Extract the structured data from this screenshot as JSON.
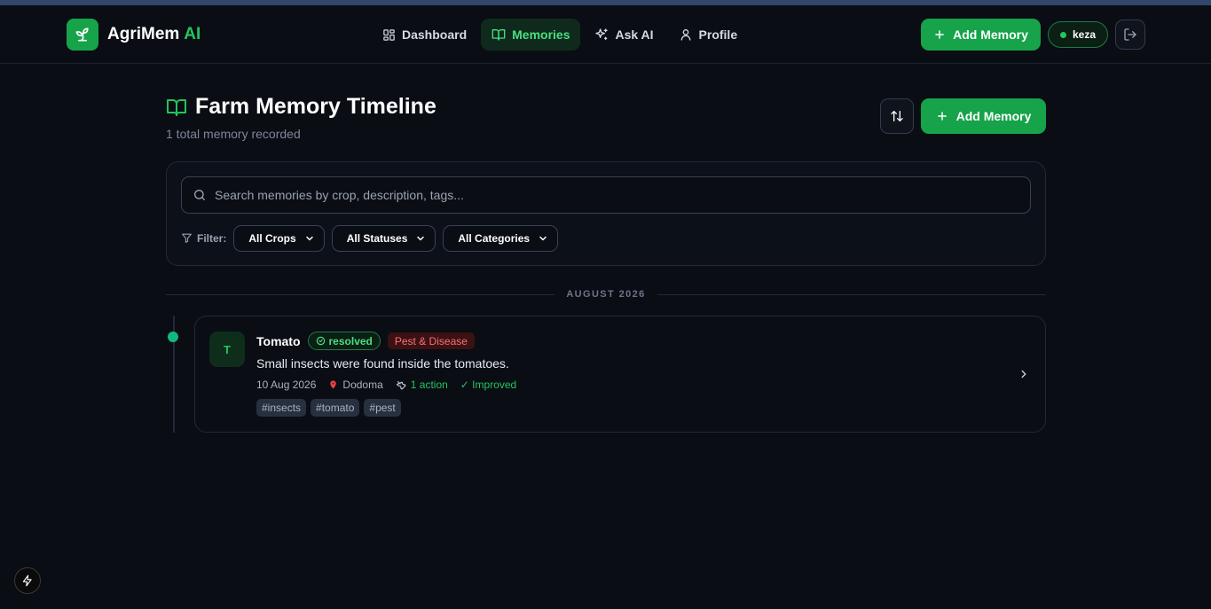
{
  "brand": {
    "name": "AgriMem",
    "suffix": "AI"
  },
  "nav": {
    "items": [
      {
        "label": "Dashboard",
        "icon": "grid-icon",
        "active": false
      },
      {
        "label": "Memories",
        "icon": "book-open-icon",
        "active": true
      },
      {
        "label": "Ask AI",
        "icon": "sparkles-icon",
        "active": false
      },
      {
        "label": "Profile",
        "icon": "user-icon",
        "active": false
      }
    ]
  },
  "header": {
    "add_label": "Add Memory",
    "username": "keza"
  },
  "page": {
    "title": "Farm Memory Timeline",
    "subtitle": "1 total memory recorded",
    "add_label": "Add Memory"
  },
  "search": {
    "placeholder": "Search memories by crop, description, tags..."
  },
  "filters": {
    "label": "Filter:",
    "crops": "All Crops",
    "statuses": "All Statuses",
    "categories": "All Categories"
  },
  "timeline": {
    "groups": [
      {
        "month": "AUGUST 2026",
        "memories": [
          {
            "initial": "T",
            "crop": "Tomato",
            "status": "resolved",
            "category": "Pest & Disease",
            "description": "Small insects were found inside the tomatoes.",
            "date": "10 Aug 2026",
            "location": "Dodoma",
            "actions": "1 action",
            "outcome": "✓ Improved",
            "tags": [
              "#insects",
              "#tomato",
              "#pest"
            ]
          }
        ]
      }
    ]
  },
  "colors": {
    "accent": "#16a34a",
    "accent_text": "#22c55e",
    "background": "#0a0d14",
    "danger": "#f87171"
  }
}
